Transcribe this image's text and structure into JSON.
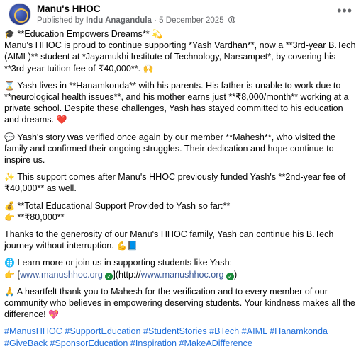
{
  "post": {
    "page_name": "Manu's HHOC",
    "published_by_label": "Published by",
    "author": "Indu Anagandula",
    "separator": "·",
    "date": "5 December 2025",
    "more_icon": "more-horizontal-icon"
  },
  "body": {
    "p1": {
      "line1_emoji": "🎓",
      "line1": " **Education Empowers Dreams** ",
      "line1_end_emoji": "💫",
      "text": "Manu's HHOC is proud to continue supporting *Yash Vardhan**, now a **3rd-year B.Tech (AIML)** student at *Jayamukhi Institute of Technology, Narsampet*, by covering his **3rd-year tuition fee of ₹40,000**. ",
      "end_emoji": "🙌"
    },
    "p2": {
      "emoji": "⌛",
      "text": " Yash lives in **Hanamkonda** with his parents. His father is unable to work due to **neurological health issues**, and his mother earns just **₹8,000/month** working at a private school. Despite these challenges, Yash has stayed committed to his education and dreams. ",
      "end_emoji": "❤️"
    },
    "p3": {
      "emoji": "💬",
      "text": " Yash's story was verified once again by our member **Mahesh**, who visited the family and confirmed their ongoing struggles. Their dedication and hope continue to inspire us."
    },
    "p4": {
      "emoji": "✨",
      "text": " This support comes after Manu's HHOC previously funded Yash's **2nd-year fee of ₹40,000** as well."
    },
    "p5": {
      "line1_emoji": "💰",
      "line1": " **Total Educational Support Provided to Yash so far:**",
      "line2_emoji": "👉",
      "line2": " **₹80,000**"
    },
    "p6": {
      "text": "Thanks to the generosity of our Manu's HHOC family, Yash can continue his B.Tech journey without interruption. ",
      "end_emoji": "💪📘"
    },
    "p7": {
      "line1_emoji": "🌐",
      "line1": " Learn more or join us in supporting students like Yash:",
      "line2_emoji": "👉",
      "open": " [",
      "url1": "www.manushhoc.org",
      "mid": "](http://",
      "url2": "www.manushhoc.org",
      "close": ")",
      "check": "✓"
    },
    "p8": {
      "emoji": "🙏",
      "text": " A heartfelt thank you to Mahesh for the verification and to every member of our community who believes in empowering deserving students. Your kindness makes all the difference! ",
      "end_emoji": "💖"
    },
    "hashtags": [
      "#ManusHHOC",
      "#SupportEducation",
      "#StudentStories",
      "#BTech",
      "#AIML",
      "#Hanamkonda",
      "#GiveBack",
      "#SponsorEducation",
      "#Inspiration",
      "#MakeADifference"
    ]
  }
}
